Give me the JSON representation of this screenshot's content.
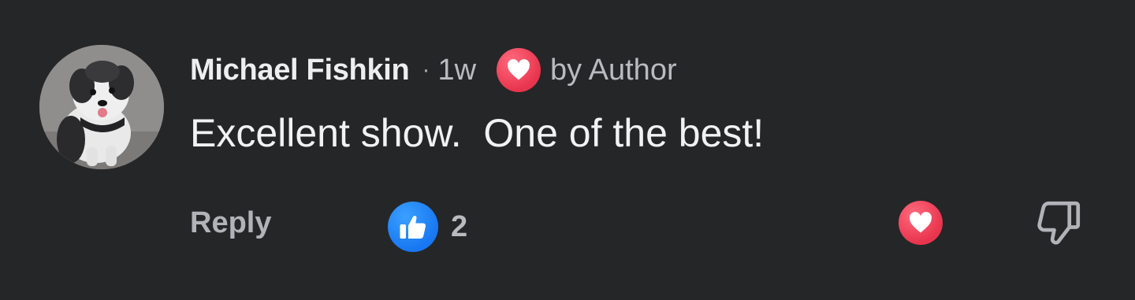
{
  "comment": {
    "author": "Michael Fishkin",
    "separator": "·",
    "time": "1w",
    "author_reaction_label": "by Author",
    "text": "Excellent show.  One of the best!",
    "reply_label": "Reply",
    "like_count": "2"
  },
  "icons": {
    "avatar": "dog-photo-avatar",
    "author_reaction": "heart-icon",
    "like_badge": "thumbs-up-icon",
    "love_button": "heart-icon",
    "dislike_button": "thumbs-down-icon"
  },
  "colors": {
    "background": "#252628",
    "primary_text": "#eceef0",
    "secondary_text": "#b8bbbf",
    "like_blue": "#1877f2",
    "love_red": "#e8344d"
  }
}
